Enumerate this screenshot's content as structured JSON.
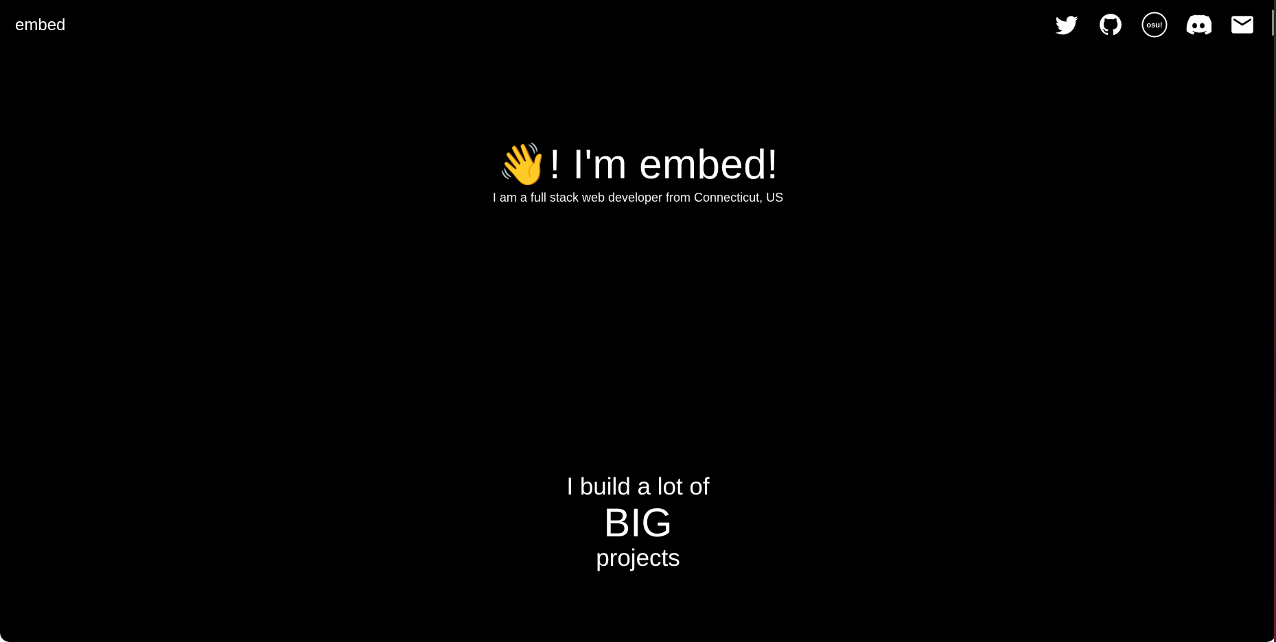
{
  "header": {
    "site_name": "embed",
    "links": [
      {
        "icon": "twitter-icon",
        "label": "Twitter"
      },
      {
        "icon": "github-icon",
        "label": "GitHub"
      },
      {
        "icon": "osu-icon",
        "label": "osu!",
        "text": "osu!"
      },
      {
        "icon": "discord-icon",
        "label": "Discord"
      },
      {
        "icon": "mail-icon",
        "label": "Email"
      }
    ]
  },
  "hero": {
    "wave_emoji": "👋",
    "title": "! I'm embed!",
    "subtitle": "I am a full stack web developer from Connecticut, US"
  },
  "projects": {
    "line1": "I build a lot of",
    "line2": "BIG",
    "line3": "projects"
  },
  "colors": {
    "background": "#000000",
    "text": "#ffffff"
  }
}
